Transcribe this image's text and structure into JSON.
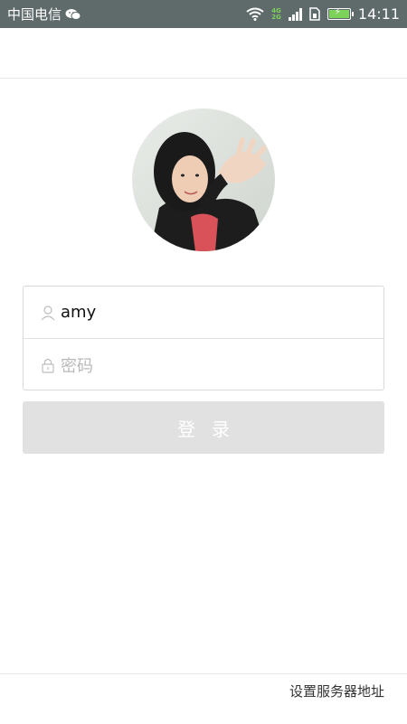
{
  "status_bar": {
    "carrier": "中国电信",
    "network_tags": [
      "4G",
      "2G"
    ],
    "time": "14:11",
    "icons": [
      "wechat-icon",
      "wifi-icon",
      "signal-icon",
      "sim-icon",
      "battery-charging-icon"
    ],
    "accent_color": "#7cd35a"
  },
  "login": {
    "username_value": "amy",
    "password_placeholder": "密码",
    "login_button_label": "登录",
    "icons": {
      "username": "user-icon",
      "password": "lock-icon"
    }
  },
  "footer": {
    "server_settings_label": "设置服务器地址"
  },
  "colors": {
    "status_bar_bg": "#5f6a6b",
    "button_bg": "#e1e1e1"
  }
}
